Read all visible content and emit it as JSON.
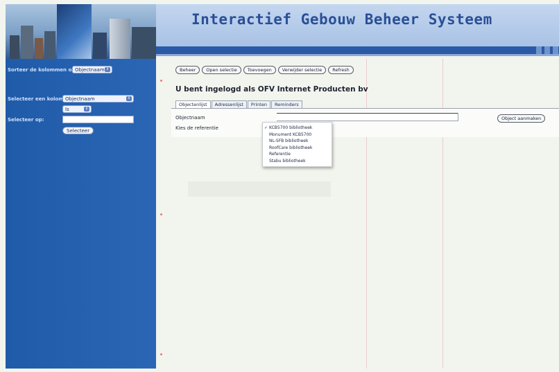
{
  "header": {
    "title": "Interactief Gebouw Beheer Systeem"
  },
  "sidebar": {
    "sort_label": "Sorteer de kolommen op:",
    "sort_value": "Objectnaam",
    "select_column_label": "Selecteer een kolom:",
    "select_column_value": "Objectnaam",
    "operator_value": "Is",
    "select_on_label": "Selecteer op:",
    "select_on_value": "",
    "select_button": "Selecteer"
  },
  "toolbar": {
    "buttons": [
      "Beheer",
      "Open selectie",
      "Toevoegen",
      "Verwijder selectie",
      "Refresh"
    ]
  },
  "main": {
    "logged_in_text": "U bent ingelogd als OFV Internet Producten bv",
    "tabs": [
      "Objectenlijst",
      "Adressenlijst",
      "Printen",
      "Reminders"
    ],
    "active_tab": "Objectenlijst",
    "objectnaam_label": "Objectnaam",
    "objectnaam_value": "",
    "referentie_label": "Kies de referentie",
    "add_object_button": "Object aanmaken"
  },
  "referentie_dropdown": {
    "selected": "KCB5700 bibliotheek",
    "options": [
      "KCB5700 bibliotheek",
      "Monument KCB5700",
      "NL-SFB bibliotheek",
      "RoofCare bibliotheek",
      "Referentie",
      "Stabu bibliotheek"
    ]
  },
  "colors": {
    "sidebar_blue": "#2560ad",
    "title_blue": "#2a4f96",
    "page_background": "#f2f5ee"
  }
}
